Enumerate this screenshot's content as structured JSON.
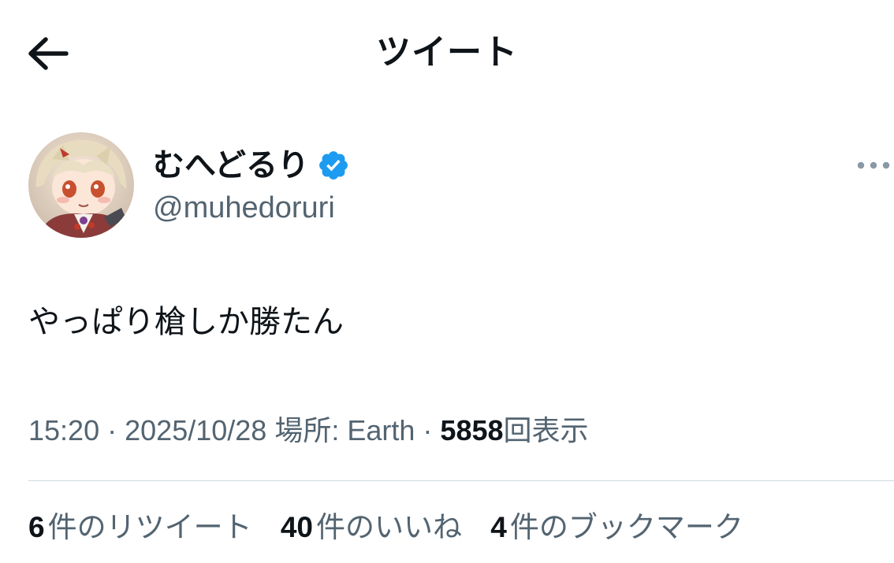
{
  "header": {
    "back_icon": "back-arrow-icon",
    "title": "ツイート"
  },
  "author": {
    "display_name": "むへどるり",
    "verified_icon": "verified-badge-icon",
    "verified_color": "#1d9bf0",
    "handle": "@muhedoruri",
    "more_icon": "more-horizontal-icon"
  },
  "tweet": {
    "text": "やっぱり槍しか勝たん"
  },
  "meta": {
    "time": "15:20",
    "separator": "·",
    "date": "2025/10/28",
    "location_label": "場所: Earth",
    "views_count": "5858",
    "views_label": "回表示"
  },
  "stats": {
    "retweets_count": "6",
    "retweets_label": "件のリツイート",
    "likes_count": "40",
    "likes_label": "件のいいね",
    "bookmarks_count": "4",
    "bookmarks_label": "件のブックマーク"
  },
  "colors": {
    "text_primary": "#0f1419",
    "text_secondary": "#536471",
    "divider": "#cfd9de",
    "accent": "#1d9bf0"
  }
}
